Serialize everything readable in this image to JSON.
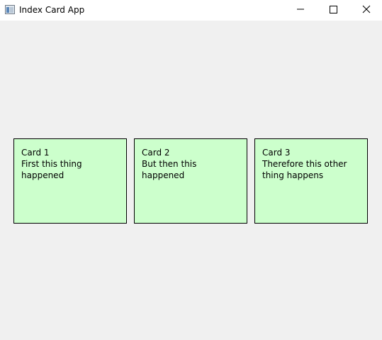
{
  "window": {
    "title": "Index Card App",
    "icons": {
      "app": "app-window-icon",
      "minimize": "minimize-icon",
      "maximize": "maximize-icon",
      "close": "close-icon"
    }
  },
  "cards": [
    {
      "title": "Card 1",
      "text": "First this thing happened"
    },
    {
      "title": "Card 2",
      "text": "But then this happened"
    },
    {
      "title": "Card 3",
      "text": "Therefore this other thing happens"
    }
  ],
  "colors": {
    "background": "#f0f0f0",
    "titlebar": "#ffffff",
    "card_background": "#ccffcc",
    "card_border": "#000000"
  }
}
